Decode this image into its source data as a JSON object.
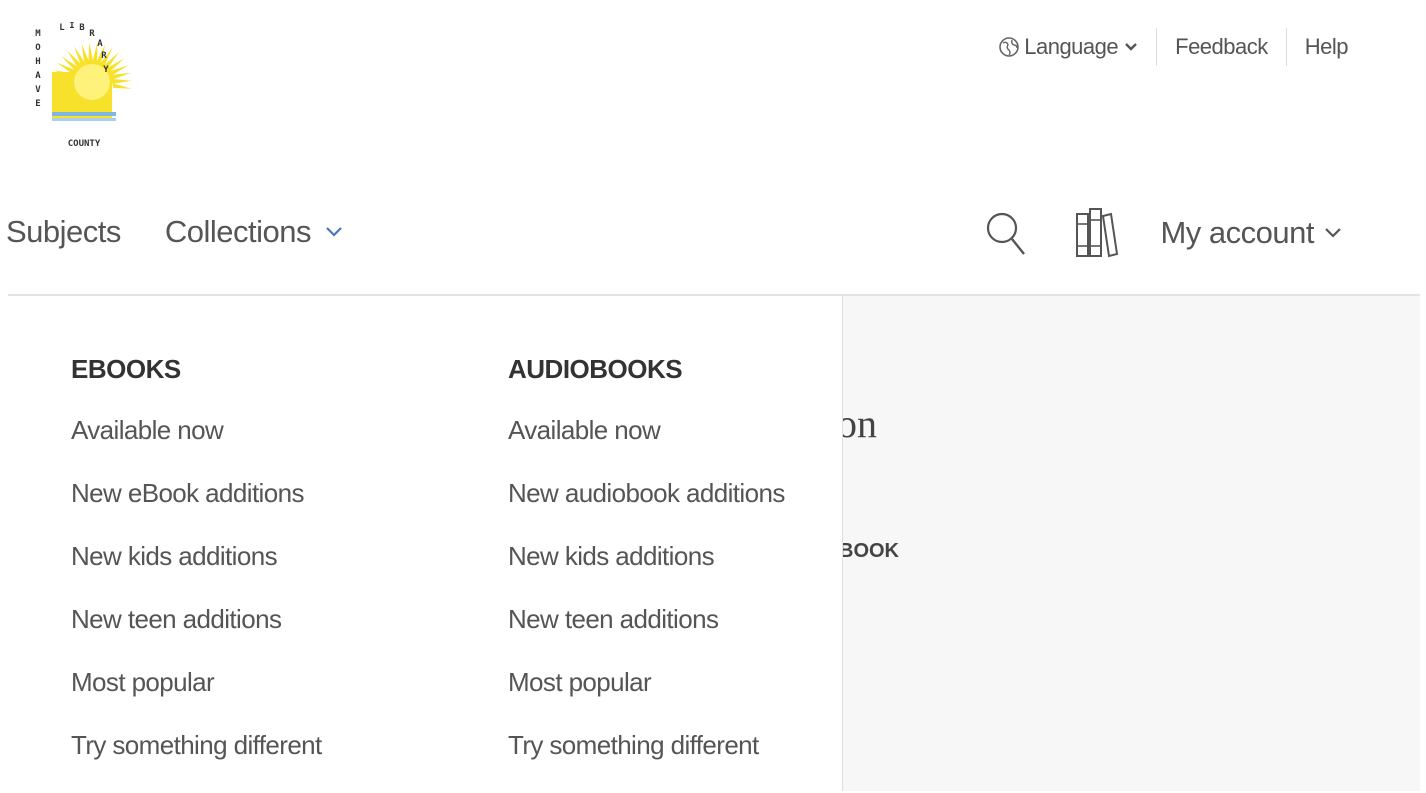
{
  "logo": {
    "word_top": "LIBRARY",
    "word_left": "MOHAVE",
    "word_bottom": "COUNTY",
    "sun_color": "#f7e12a",
    "water_color": "#7fb6e3"
  },
  "utility_nav": {
    "language": "Language",
    "feedback": "Feedback",
    "help": "Help"
  },
  "main_nav": {
    "subjects": "Subjects",
    "collections": "Collections",
    "my_account": "My account"
  },
  "icons": {
    "globe": "globe-icon",
    "search": "search-icon",
    "shelf": "bookshelf-icon",
    "chevron": "chevron-down-icon"
  },
  "colors": {
    "collections_chevron": "#4a78b5"
  },
  "dropdown": {
    "ebooks": {
      "heading": "EBOOKS",
      "items": [
        "Available now",
        "New eBook additions",
        "New kids additions",
        "New teen additions",
        "Most popular",
        "Try something different"
      ]
    },
    "audiobooks": {
      "heading": "AUDIOBOOKS",
      "items": [
        "Available now",
        "New audiobook additions",
        "New kids additions",
        "New teen additions",
        "Most popular",
        "Try something different"
      ]
    }
  },
  "background_content": {
    "title_fragment": "on",
    "label_fragment": "BOOK"
  }
}
